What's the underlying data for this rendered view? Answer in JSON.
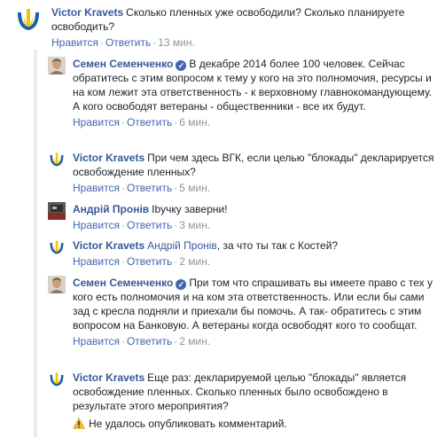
{
  "comments": [
    {
      "author": "Victor Kravets",
      "mention": "",
      "verified": false,
      "text": "Сколько пленных уже освободили? Сколько планируете освободить?",
      "actions": {
        "like": "Нравится",
        "reply": "Ответить",
        "time": "13 мин."
      }
    },
    {
      "author": "Семен Семенченко",
      "mention": "",
      "verified": true,
      "text": "В декабре 2014 более 100 человек. Сейчас обратитесь с этим вопросом к тему у кого на это полномочия, ресурсы и на ком лежит эта ответственность - к верховному главнокомандующему. А кого освободят ветераны - общественники - все их будут.",
      "actions": {
        "like": "Нравится",
        "reply": "Ответить",
        "time": "6 мин."
      }
    },
    {
      "author": "Victor Kravets",
      "mention": "",
      "verified": false,
      "text": "При чем здесь ВГК, если целью \"блокады\" декларируется освобождение пленных?",
      "actions": {
        "like": "Нравится",
        "reply": "Ответить",
        "time": "5 мин."
      }
    },
    {
      "author": "Андрій Пронів",
      "mention": "",
      "verified": false,
      "text": "Ibучку заверни!",
      "actions": {
        "like": "Нравится",
        "reply": "Ответить",
        "time": "3 мин."
      }
    },
    {
      "author": "Victor Kravets",
      "mention": "Андрій Пронів",
      "verified": false,
      "text": ", за что ты так с Костей?",
      "actions": {
        "like": "Нравится",
        "reply": "Ответить",
        "time": "2 мин."
      }
    },
    {
      "author": "Семен Семенченко",
      "mention": "",
      "verified": true,
      "text": "При том что спрашивать вы имеете право с тех у кого есть полномочия и на ком эта ответственность. Или если бы сами зад с кресла подняли и приехали бы помочь. А так- обратитесь с этим вопросом на Банковую. А ветераны когда освободят кого то сообщат.",
      "actions": {
        "like": "Нравится",
        "reply": "Ответить",
        "time": "2 мин."
      }
    },
    {
      "author": "Victor Kravets",
      "mention": "",
      "verified": false,
      "text": "Еще раз: декларируемой целью \"блокады\" является освобождение пленных. Сколько пленных было освобождено в результате этого мероприятия?",
      "error": "Не удалось опубликовать комментарий."
    }
  ],
  "colors": {
    "link": "#365899",
    "action": "#4267b2",
    "meta": "#90949c",
    "text": "#1d2129",
    "thread_line": "#e9ebee"
  },
  "icons": {
    "verified": "verified-badge-icon",
    "warning": "warning-triangle-icon",
    "logo_avatar": "ukrainian-trident-logo-avatar"
  }
}
